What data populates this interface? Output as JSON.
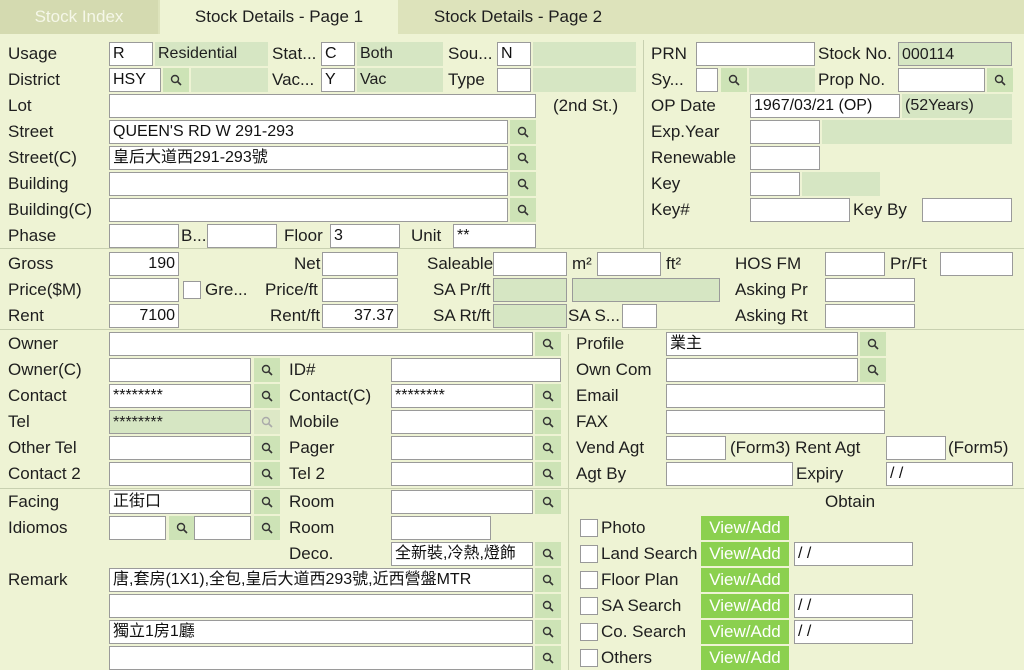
{
  "tabs": {
    "index": "Stock Index",
    "page1": "Stock Details - Page 1",
    "page2": "Stock Details - Page 2"
  },
  "labels": {
    "usage": "Usage",
    "district": "District",
    "lot": "Lot",
    "street": "Street",
    "street_c": "Street(C)",
    "building": "Building",
    "building_c": "Building(C)",
    "phase": "Phase",
    "stat": "Stat...",
    "vac": "Vac...",
    "sou": "Sou...",
    "type": "Type",
    "second_st": "(2nd St.)",
    "b": "B...",
    "floor": "Floor",
    "unit": "Unit",
    "prn": "PRN",
    "stock_no": "Stock No.",
    "sy": "Sy...",
    "prop_no": "Prop No.",
    "op_date": "OP Date",
    "op_years": "(52Years)",
    "exp_year": "Exp.Year",
    "renewable": "Renewable",
    "key": "Key",
    "key_hash": "Key#",
    "key_by": "Key By",
    "gross": "Gross",
    "net": "Net",
    "saleable": "Saleable",
    "m2": "m²",
    "ft2": "ft²",
    "hos_fm": "HOS FM",
    "pr_ft": "Pr/Ft",
    "price": "Price($M)",
    "gre": "Gre...",
    "price_ft": "Price/ft",
    "sa_pr_ft": "SA Pr/ft",
    "asking_pr": "Asking Pr",
    "rent": "Rent",
    "rent_ft": "Rent/ft",
    "sa_rt_ft": "SA Rt/ft",
    "sa_s": "SA S...",
    "asking_rt": "Asking Rt",
    "owner": "Owner",
    "owner_c": "Owner(C)",
    "contact": "Contact",
    "tel": "Tel",
    "other_tel": "Other Tel",
    "contact2": "Contact 2",
    "id_no": "ID#",
    "contact_c": "Contact(C)",
    "mobile": "Mobile",
    "pager": "Pager",
    "tel2": "Tel 2",
    "profile": "Profile",
    "own_com": "Own Com",
    "email": "Email",
    "fax": "FAX",
    "vend_agt": "Vend Agt",
    "form3": "(Form3) Rent Agt",
    "form5": "(Form5)",
    "agt_by": "Agt By",
    "expiry": "Expiry",
    "facing": "Facing",
    "idiomos": "Idiomos",
    "room1": "Room",
    "room2": "Room",
    "deco": "Deco.",
    "remark": "Remark",
    "obtain": "Obtain",
    "photo": "Photo",
    "land_search": "Land Search",
    "floor_plan": "Floor Plan",
    "sa_search": "SA Search",
    "co_search": "Co. Search",
    "others": "Others",
    "view_add": "View/Add"
  },
  "values": {
    "usage": "R",
    "usage_desc": "Residential",
    "stat": "C",
    "stat_desc": "Both",
    "sou": "N",
    "district": "HSY",
    "vac": "Y",
    "vac_desc": "Vac",
    "type": "",
    "lot": "",
    "street": "QUEEN'S RD W 291-293",
    "street_c": "皇后大道西291-293號",
    "building": "",
    "building_c": "",
    "phase": "",
    "b": "",
    "floor": "3",
    "unit": "**",
    "prn": "",
    "stock_no": "000114",
    "sy": "",
    "prop_no": "",
    "op_date": "1967/03/21 (OP)",
    "exp_year": "",
    "renewable": "",
    "key": "",
    "key_hash": "",
    "key_by": "",
    "gross": "190",
    "net": "",
    "saleable": "",
    "m2": "",
    "hos_fm": "",
    "pr_ft": "",
    "price": "",
    "price_ft": "",
    "sa_pr_ft": "",
    "sa_pr_ft2": "",
    "asking_pr": "",
    "rent": "7100",
    "rent_ft": "37.37",
    "sa_rt_ft": "",
    "sa_s": "",
    "asking_rt": "",
    "owner": "",
    "owner_c": "",
    "contact": "********",
    "tel": "********",
    "other_tel": "",
    "contact2": "",
    "id_no": "",
    "contact_c": "********",
    "mobile": "",
    "pager": "",
    "tel2": "",
    "profile": "業主",
    "own_com": "",
    "email": "",
    "fax": "",
    "vend_agt": "",
    "rent_agt": "",
    "agt_by": "",
    "expiry": " / /",
    "facing": "正街口",
    "idiomos1": "",
    "idiomos2": "",
    "room1": "",
    "room2": "",
    "deco": "全新裝,冷熱,燈飾",
    "remark1": "唐,套房(1X1),全包,皇后大道西293號,近西營盤MTR",
    "remark2": "",
    "remark3": "獨立1房1廳",
    "remark4": "",
    "land_search_date": " / /",
    "sa_search_date": " / /",
    "co_search_date": " / /"
  },
  "colors": {
    "background": "#eef3d4",
    "readonly": "#d6e6c3",
    "view_button": "#8bd04f",
    "search_button": "#cde3b6"
  },
  "icons": {
    "search": "search-icon"
  }
}
